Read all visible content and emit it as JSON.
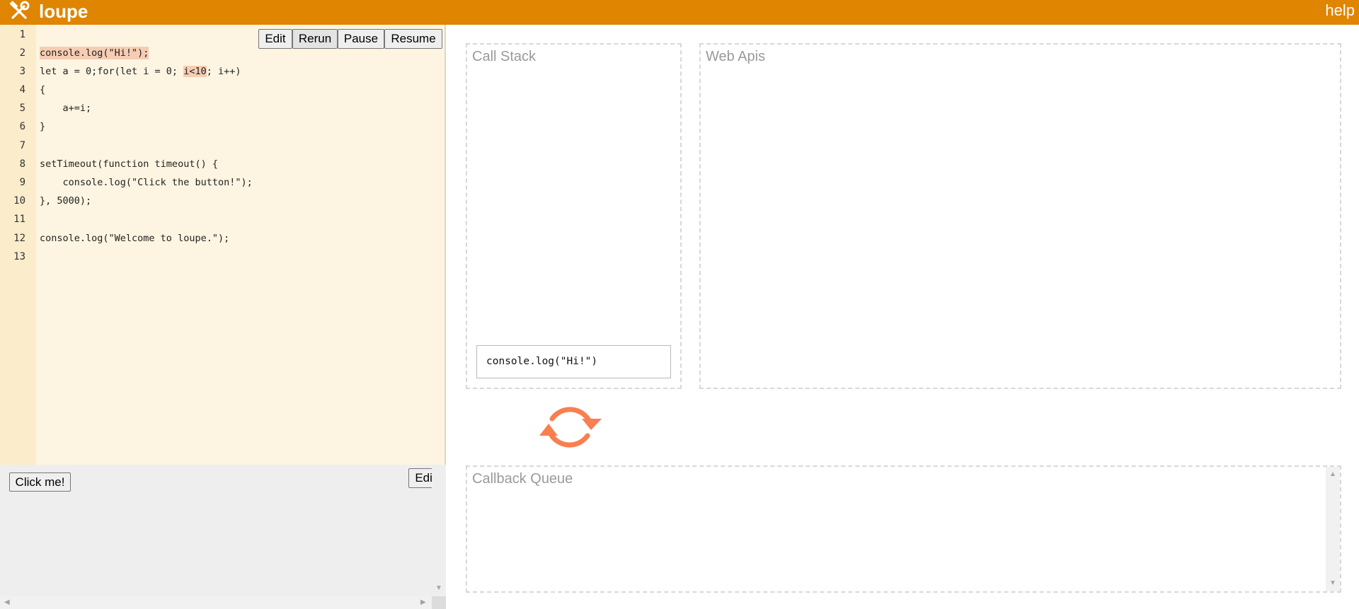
{
  "header": {
    "app_name": "loupe",
    "logo_icon": "hammer-wrench-icon",
    "help_label": "help",
    "bg_color": "#df8502"
  },
  "editor": {
    "buttons": {
      "edit": "Edit",
      "rerun": "Rerun",
      "pause": "Pause",
      "resume": "Resume"
    },
    "line_numbers": [
      "1",
      "2",
      "3",
      "4",
      "5",
      "6",
      "7",
      "8",
      "9",
      "10",
      "11",
      "12",
      "13"
    ],
    "lines": [
      "",
      "console.log(\"Hi!\");",
      "let a = 0;for(let i = 0; i<10; i++)",
      "{",
      "    a+=i;",
      "}",
      "",
      "setTimeout(function timeout() {",
      "    console.log(\"Click the button!\");",
      "}, 5000);",
      "",
      "console.log(\"Welcome to loupe.\");",
      ""
    ],
    "line3_parts": {
      "before": "let a = 0;for(let i = 0; ",
      "highlight": "i<10",
      "after": "; i++)"
    },
    "highlight_color": "#f6cdb3"
  },
  "html_pane": {
    "click_button_label": "Click me!",
    "edit_label": "Edit"
  },
  "call_stack": {
    "title": "Call Stack",
    "frames": [
      "console.log(\"Hi!\")"
    ]
  },
  "web_apis": {
    "title": "Web Apis"
  },
  "event_loop": {
    "icon": "refresh-cycle-icon",
    "color": "#fa7e4f"
  },
  "callback_queue": {
    "title": "Callback Queue"
  }
}
